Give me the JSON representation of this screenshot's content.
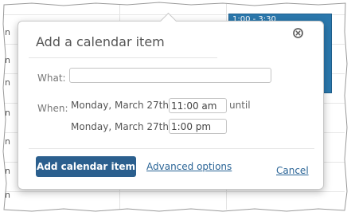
{
  "calendar": {
    "hour_labels": [
      "n",
      "n",
      "n",
      "n",
      "n",
      "n",
      "n"
    ],
    "event_time": "1:00 - 3:30",
    "event_color": "#2b78ad"
  },
  "popup": {
    "title": "Add a calendar item",
    "close_icon": "close-circle-icon",
    "what_label": "What:",
    "what_value": "",
    "when_label": "When:",
    "start_date": "Monday, March 27th",
    "start_time": "11:00 am",
    "until_label": "until",
    "end_date": "Monday, March 27th",
    "end_time": "1:00 pm",
    "add_button_label": "Add calendar item",
    "advanced_options_label": "Advanced options",
    "cancel_label": "Cancel",
    "accent_color": "#2b5f8e",
    "link_color": "#2a6496"
  }
}
